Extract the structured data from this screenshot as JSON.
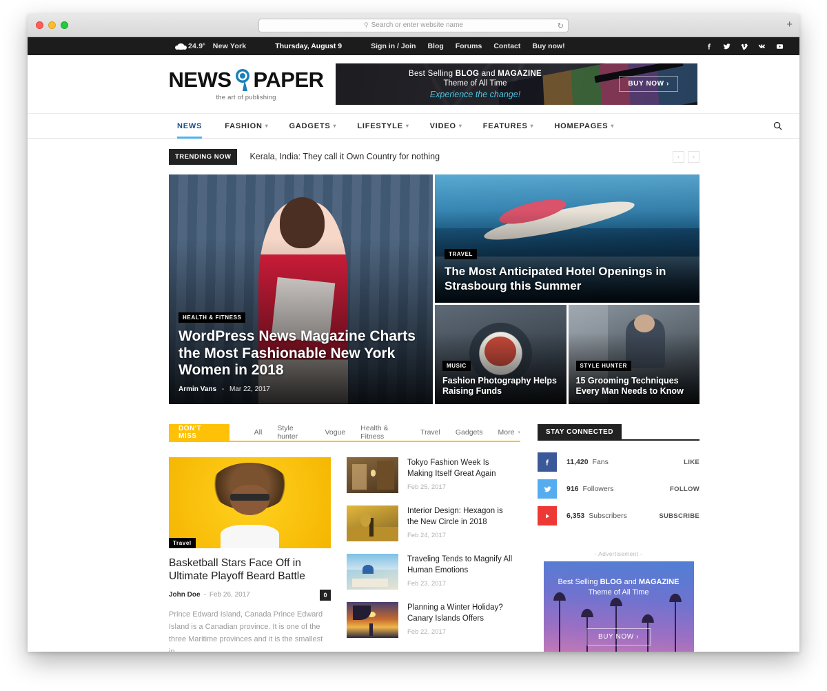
{
  "browser": {
    "url_placeholder": "Search or enter website name",
    "search_icon": "search-icon",
    "reload_icon": "reload-icon",
    "newtab_label": "+"
  },
  "topbar": {
    "temperature": "24.9",
    "temperature_unit": "c",
    "city": "New York",
    "date": "Thursday, August 9",
    "links": [
      "Sign in / Join",
      "Blog",
      "Forums",
      "Contact",
      "Buy now!"
    ],
    "social": [
      "facebook-icon",
      "twitter-icon",
      "vimeo-icon",
      "vk-icon",
      "youtube-icon"
    ]
  },
  "logo": {
    "word_left": "NEWS",
    "word_right": "PAPER",
    "tagline": "the art of publishing"
  },
  "header_banner": {
    "line1_pre": "Best Selling ",
    "line1_b1": "BLOG",
    "line1_mid": " and ",
    "line1_b2": "MAGAZINE",
    "line2": "Theme of All Time",
    "line3": "Experience the change!",
    "cta": "BUY NOW  ›"
  },
  "nav": {
    "items": [
      {
        "label": "NEWS",
        "has_caret": false,
        "active": true
      },
      {
        "label": "FASHION",
        "has_caret": true,
        "active": false
      },
      {
        "label": "GADGETS",
        "has_caret": true,
        "active": false
      },
      {
        "label": "LIFESTYLE",
        "has_caret": true,
        "active": false
      },
      {
        "label": "VIDEO",
        "has_caret": true,
        "active": false
      },
      {
        "label": "FEATURES",
        "has_caret": true,
        "active": false
      },
      {
        "label": "HOMEPAGES",
        "has_caret": true,
        "active": false
      }
    ],
    "search_icon": "search-icon"
  },
  "trending": {
    "badge": "TRENDING NOW",
    "headline": "Kerala, India: They call it Own Country for nothing",
    "prev": "‹",
    "next": "›"
  },
  "featured": {
    "big": {
      "category": "HEALTH & FITNESS",
      "title": "WordPress News Magazine Charts the Most Fashionable New York Women in 2018",
      "author": "Armin Vans",
      "date": "Mar 22, 2017",
      "separator": "-"
    },
    "wide": {
      "category": "TRAVEL",
      "title": "The Most Anticipated Hotel Openings in Strasbourg this Summer"
    },
    "small_left": {
      "category": "MUSIC",
      "title": "Fashion Photography Helps Raising Funds"
    },
    "small_right": {
      "category": "STYLE HUNTER",
      "title": "15 Grooming Techniques Every Man Needs to Know"
    }
  },
  "dont_miss": {
    "tab": "DON'T MISS",
    "filters": [
      "All",
      "Style hunter",
      "Vogue",
      "Health & Fitness",
      "Travel",
      "Gadgets",
      "More"
    ],
    "lead": {
      "category": "Travel",
      "title": "Basketball Stars Face Off in Ultimate Playoff Beard Battle",
      "author": "John Doe",
      "date": "Feb 26, 2017",
      "comments": "0",
      "excerpt": "Prince Edward Island, Canada Prince Edward Island is a Canadian province. It is one of the three Maritime provinces and it is the smallest in..."
    },
    "list": [
      {
        "title": "Tokyo Fashion Week Is Making Itself Great Again",
        "date": "Feb 25, 2017"
      },
      {
        "title": "Interior Design: Hexagon is the New Circle in 2018",
        "date": "Feb 24, 2017"
      },
      {
        "title": "Traveling Tends to Magnify All Human Emotions",
        "date": "Feb 23, 2017"
      },
      {
        "title": "Planning a Winter Holiday? Canary Islands Offers",
        "date": "Feb 22, 2017"
      }
    ]
  },
  "sidebar": {
    "stay_connected_title": "STAY CONNECTED",
    "networks": [
      {
        "icon": "facebook-icon",
        "count": "11,420",
        "label": "Fans",
        "action": "LIKE",
        "color": "#3b5998"
      },
      {
        "icon": "twitter-icon",
        "count": "916",
        "label": "Followers",
        "action": "FOLLOW",
        "color": "#55acee"
      },
      {
        "icon": "youtube-icon",
        "count": "6,353",
        "label": "Subscribers",
        "action": "SUBSCRIBE",
        "color": "#ed3833"
      }
    ],
    "ad": {
      "label": "- Advertisement -",
      "line1_pre": "Best Selling ",
      "line1_b1": "BLOG",
      "line1_mid": " and ",
      "line1_b2": "MAGAZINE",
      "line2": "Theme of All Time",
      "cta": "BUY NOW  ›"
    }
  }
}
